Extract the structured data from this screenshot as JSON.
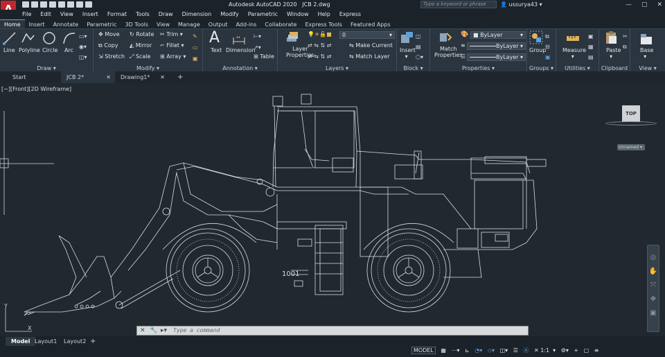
{
  "app": {
    "logo": "A",
    "title": "Autodesk AutoCAD 2020",
    "file": "JCB 2.dwg",
    "search_placeholder": "Type a keyword or phrase",
    "user": "ussurya43"
  },
  "menu": [
    "File",
    "Edit",
    "View",
    "Insert",
    "Format",
    "Tools",
    "Draw",
    "Dimension",
    "Modify",
    "Parametric",
    "Window",
    "Help",
    "Express"
  ],
  "ribbon_tabs": [
    "Home",
    "Insert",
    "Annotate",
    "Parametric",
    "3D Tools",
    "View",
    "Manage",
    "Output",
    "Add-ins",
    "Collaborate",
    "Express Tools",
    "Featured Apps"
  ],
  "panels": {
    "draw": {
      "label": "Draw",
      "tools": [
        "Line",
        "Polyline",
        "Circle",
        "Arc"
      ]
    },
    "modify": {
      "label": "Modify",
      "tools": [
        "Move",
        "Rotate",
        "Trim",
        "Copy",
        "Mirror",
        "Fillet",
        "Stretch",
        "Scale",
        "Array"
      ]
    },
    "annotation": {
      "label": "Annotation",
      "tools": [
        "Text",
        "Dimension",
        "Table"
      ]
    },
    "layers": {
      "label": "Layers",
      "layer_props": "Layer Properties",
      "current_layer": "0",
      "make_current": "Make Current",
      "match_layer": "Match Layer"
    },
    "block": {
      "label": "Block",
      "insert": "Insert"
    },
    "properties": {
      "label": "Properties",
      "match": "Match Properties",
      "color": "ByLayer",
      "linetype": "ByLayer",
      "lineweight": "ByLayer"
    },
    "groups": {
      "label": "Groups",
      "group": "Group"
    },
    "utilities": {
      "label": "Utilities",
      "measure": "Measure"
    },
    "clipboard": {
      "label": "Clipboard",
      "paste": "Paste"
    },
    "view": {
      "label": "View",
      "base": "Base"
    }
  },
  "doc_tabs": [
    "Start",
    "JCB 2*",
    "Drawing1*"
  ],
  "viewport": {
    "label": "[−][Front][2D Wireframe]",
    "viewcube_face": "TOP",
    "ucs_name": "Unnamed",
    "axis_y": "Y",
    "axis_x": "X"
  },
  "command": {
    "placeholder": "Type a command"
  },
  "layout_tabs": [
    "Model",
    "Layout1",
    "Layout2"
  ],
  "status": {
    "model": "MODEL",
    "scale": "1:1"
  },
  "colors": {
    "accent": "#5ea0d8",
    "logo": "#c1272d",
    "drawing_line": "#d9dee3"
  }
}
